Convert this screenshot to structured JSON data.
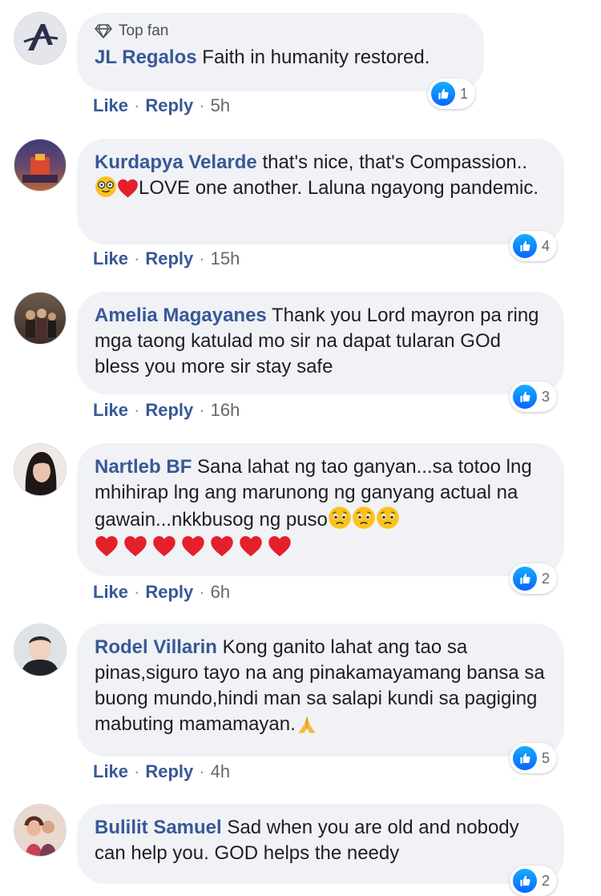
{
  "like_label": "Like",
  "reply_label": "Reply",
  "separator": "·",
  "comments": [
    {
      "author": "JL Regalos",
      "badge": "Top fan",
      "text": "Faith in humanity restored.",
      "reactions": "1",
      "time": "5h"
    },
    {
      "author": "Kurdapya Velarde",
      "text_a": "that's nice, that's Compassion..",
      "text_b": "LOVE one another. Laluna ngayong pandemic.",
      "reactions": "4",
      "time": "15h"
    },
    {
      "author": "Amelia Magayanes",
      "text": "Thank you Lord mayron pa ring mga taong katulad mo sir na dapat tularan GOd bless you more sir stay safe",
      "reactions": "3",
      "time": "16h"
    },
    {
      "author": "Nartleb BF",
      "text": "Sana lahat ng tao ganyan...sa totoo lng mhihirap lng ang marunong ng ganyang actual na gawain...nkkbusog ng puso",
      "reactions": "2",
      "time": "6h"
    },
    {
      "author": "Rodel Villarin",
      "text": "Kong ganito lahat ang tao sa pinas,siguro tayo na ang pinakamayamang bansa sa buong mundo,hindi man sa salapi kundi sa pagiging mabuting mamamayan.",
      "reactions": "5",
      "time": "4h"
    },
    {
      "author": "Bulilit Samuel",
      "text": "Sad when you are old and nobody can help you. GOD helps the needy",
      "reactions": "2"
    }
  ],
  "icons": {
    "like": "thumbs-up-icon",
    "top_fan": "diamond-icon",
    "heart": "red-heart-emoji",
    "nerd": "nerd-face-emoji",
    "sad": "pleading-face-emoji",
    "pray": "folded-hands-emoji"
  },
  "colors": {
    "author": "#385898",
    "bubble": "#f0f2f5",
    "like_blue": "#0866ff",
    "heart": "#e4202b"
  }
}
